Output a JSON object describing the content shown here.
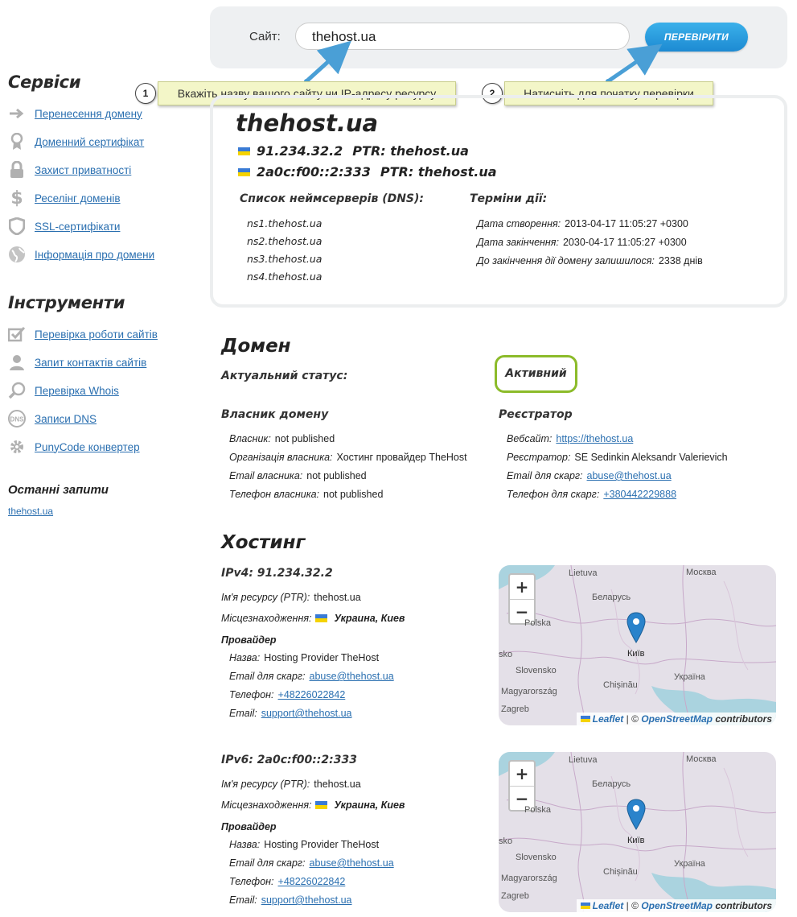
{
  "search": {
    "label": "Сайт:",
    "value": "thehost.ua",
    "button": "ПЕРЕВІРИТИ"
  },
  "callouts": [
    {
      "num": "1",
      "text": "Вкажіть назву вашого сайту чи IP-адресу ресурсу"
    },
    {
      "num": "2",
      "text": "Натисніть для початку перевірки"
    }
  ],
  "sidebar": {
    "services_title": "Сервіси",
    "services": [
      {
        "label": "Перенесення домену",
        "icon": "arrow-right-icon"
      },
      {
        "label": "Доменний сертифікат",
        "icon": "certificate-icon"
      },
      {
        "label": "Захист приватності",
        "icon": "lock-icon"
      },
      {
        "label": "Реселінг доменів",
        "icon": "dollar-icon"
      },
      {
        "label": "SSL-сертифікати",
        "icon": "shield-icon"
      },
      {
        "label": "Інформація про домени",
        "icon": "globe-icon"
      }
    ],
    "tools_title": "Інструменти",
    "tools": [
      {
        "label": "Перевірка роботи сайтів",
        "icon": "checkbox-icon"
      },
      {
        "label": "Запит контактів сайтів",
        "icon": "user-icon"
      },
      {
        "label": "Перевірка Whois",
        "icon": "magnifier-icon"
      },
      {
        "label": "Записи DNS",
        "icon": "dns-icon"
      },
      {
        "label": "PunyCode конвертер",
        "icon": "gear-icon"
      }
    ],
    "recent_title": "Останні запити",
    "recent": [
      "thehost.ua"
    ]
  },
  "summary": {
    "domain": "thehost.ua",
    "ipv4": "91.234.32.2",
    "ipv4_ptr": "PTR: thehost.ua",
    "ipv6": "2a0c:f00::2:333",
    "ipv6_ptr": "PTR: thehost.ua",
    "ns_title": "Список неймсерверів (DNS):",
    "nameservers": [
      "ns1.thehost.ua",
      "ns2.thehost.ua",
      "ns3.thehost.ua",
      "ns4.thehost.ua"
    ],
    "terms_title": "Терміни дії:",
    "created_label": "Дата створення:",
    "created": "2013-04-17 11:05:27 +0300",
    "expires_label": "Дата закінчення:",
    "expires": "2030-04-17 11:05:27 +0300",
    "left_label": "До закінчення дії домену залишилося:",
    "left": "2338 днів"
  },
  "domain_section": {
    "title": "Домен",
    "status_label": "Актуальний статус:",
    "status": "Активний",
    "owner_title": "Власник домену",
    "owner": [
      {
        "k": "Власник:",
        "v": "not published"
      },
      {
        "k": "Організація власника:",
        "v": "Хостинг провайдер TheHost"
      },
      {
        "k": "Email власника:",
        "v": "not published"
      },
      {
        "k": "Телефон власника:",
        "v": "not published"
      }
    ],
    "registrar_title": "Реєстратор",
    "website_label": "Вебсайт:",
    "website": "https://thehost.ua",
    "registrar_label": "Реєстратор:",
    "registrar": "SE Sedinkin Aleksandr Valerievich",
    "abuse_email_label": "Email для скарг:",
    "abuse_email": "abuse@thehost.ua",
    "abuse_phone_label": "Телефон для скарг:",
    "abuse_phone": "+380442229888"
  },
  "hosting": {
    "title": "Хостинг",
    "blocks": [
      {
        "heading": "IPv4: 91.234.32.2",
        "ptr_label": "Ім'я ресурсу (PTR):",
        "ptr": "thehost.ua",
        "loc_label": "Місцезнаходження:",
        "loc": "Украина, Киев",
        "provider_title": "Провайдер",
        "name_label": "Назва:",
        "name": "Hosting Provider TheHost",
        "email_label": "Email для скарг:",
        "email": "abuse@thehost.ua",
        "phone_label": "Телефон:",
        "phone": "+48226022842",
        "mail_label": "Email:",
        "mail": "support@thehost.ua"
      },
      {
        "heading": "IPv6: 2a0c:f00::2:333",
        "ptr_label": "Ім'я ресурсу (PTR):",
        "ptr": "thehost.ua",
        "loc_label": "Місцезнаходження:",
        "loc": "Украина, Киев",
        "provider_title": "Провайдер",
        "name_label": "Назва:",
        "name": "Hosting Provider TheHost",
        "email_label": "Email для скарг:",
        "email": "abuse@thehost.ua",
        "phone_label": "Телефон:",
        "phone": "+48226022842",
        "mail_label": "Email:",
        "mail": "support@thehost.ua"
      }
    ],
    "map": {
      "zoom_in": "+",
      "zoom_out": "−",
      "labels": [
        "Lietuva",
        "Москва",
        "Беларусь",
        "Polska",
        "Київ",
        "Slovensko",
        "Україна",
        "Chișinău",
        "Magyarország",
        "Zagreb",
        "sko"
      ],
      "attr_leaflet": "Leaflet",
      "attr_sep": "| ©",
      "attr_osm": "OpenStreetMap",
      "attr_tail": "contributors"
    }
  }
}
